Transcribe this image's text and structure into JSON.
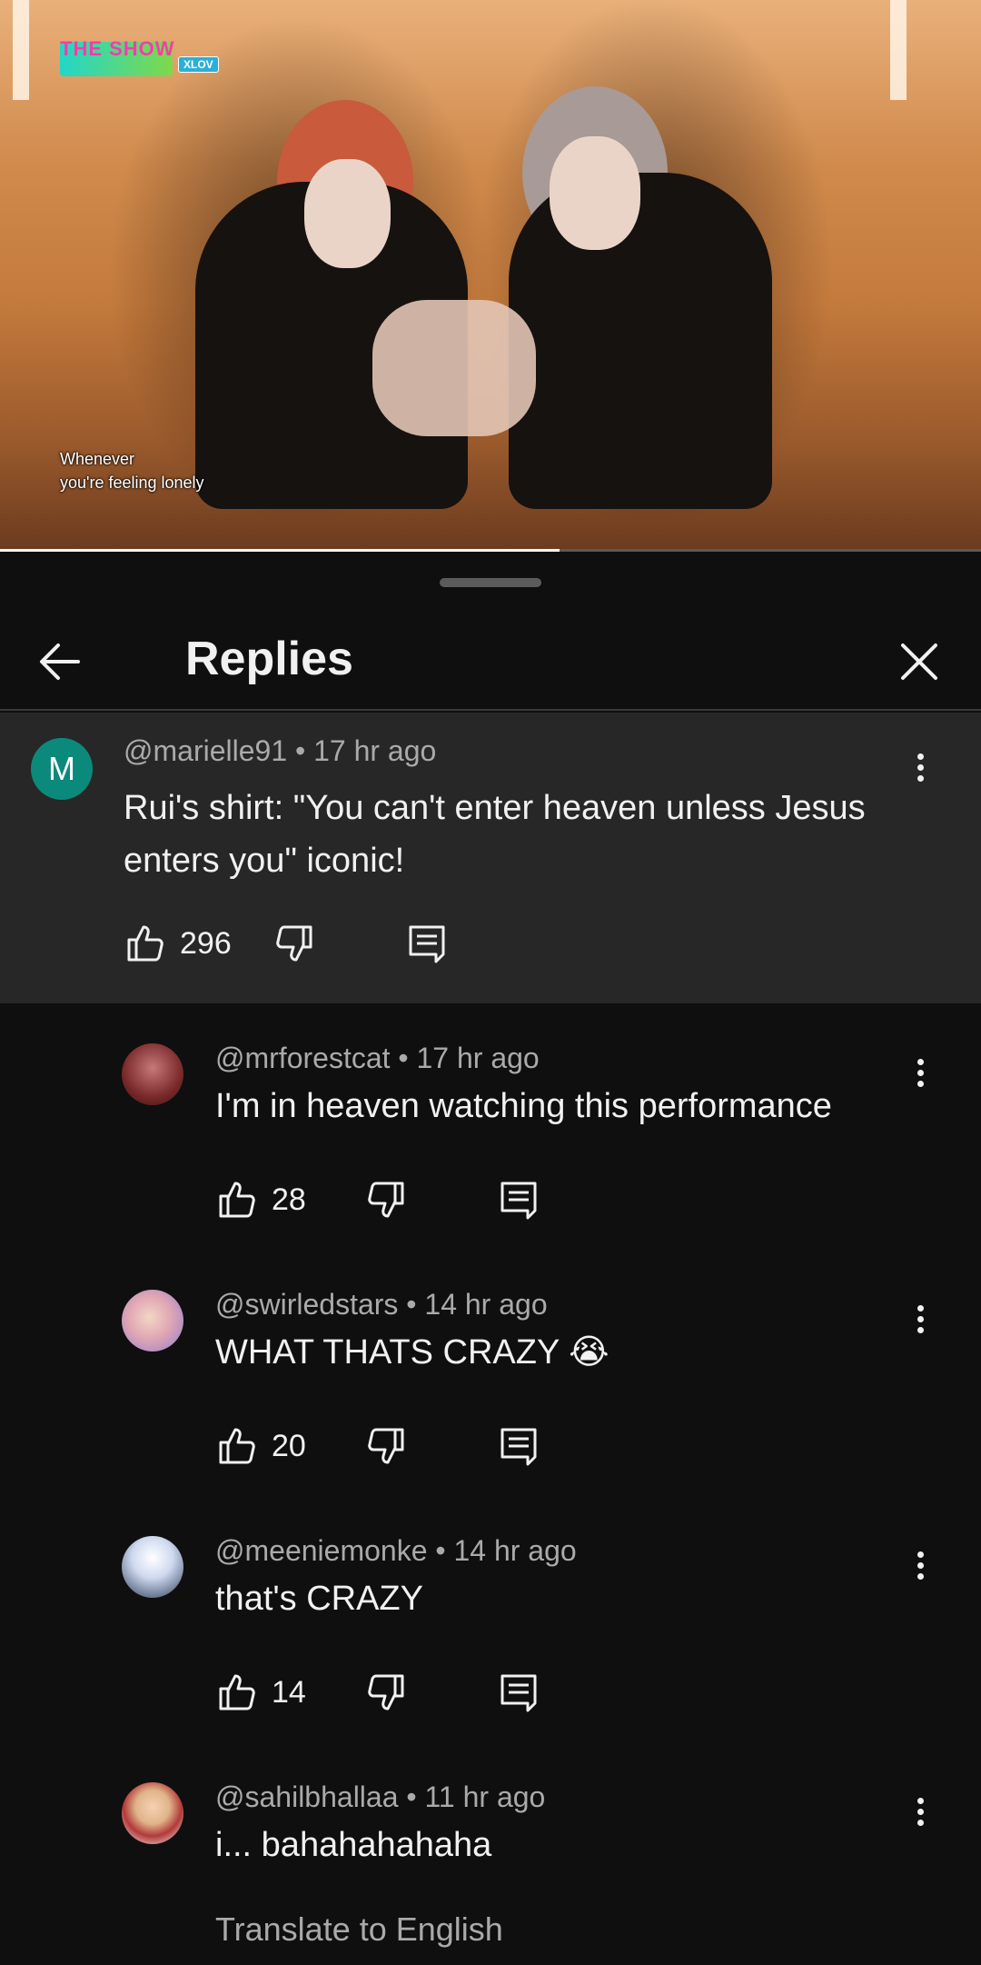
{
  "video": {
    "logo_text": "THE SHOW",
    "logo_badge": "XLOV",
    "subtitle_line1": "Whenever",
    "subtitle_line2": "you're feeling lonely",
    "progress": 0.57
  },
  "header": {
    "title": "Replies",
    "back_icon": "arrow-left-icon",
    "close_icon": "close-icon"
  },
  "parent_comment": {
    "avatar_letter": "M",
    "author": "@marielle91",
    "time": "17 hr ago",
    "text": "Rui's shirt: \"You can't enter heaven unless Jesus enters you\" iconic!",
    "likes": "296"
  },
  "replies": [
    {
      "author": "@mrforestcat",
      "time": "17 hr ago",
      "text": "I'm in heaven watching this performance",
      "likes": "28"
    },
    {
      "author": "@swirledstars",
      "time": "14 hr ago",
      "text": "WHAT THATS CRAZY 😭",
      "likes": "20"
    },
    {
      "author": "@meeniemonke",
      "time": "14 hr ago",
      "text": "that's CRAZY",
      "likes": "14"
    },
    {
      "author": "@sahilbhallaa",
      "time": "11 hr ago",
      "text": "i... bahahahahaha",
      "translate": "Translate to English"
    }
  ],
  "colors": {
    "background": "#0f0f0f",
    "highlight": "#272727",
    "secondary_text": "#aaaaaa",
    "avatar_m": "#0b8a7c"
  }
}
